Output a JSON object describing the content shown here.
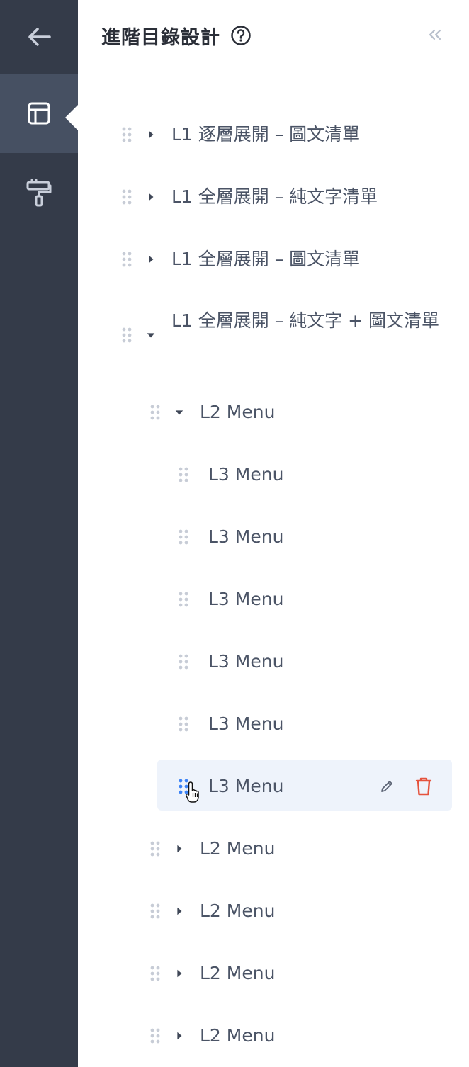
{
  "sidebar": {
    "items": [
      {
        "icon": "arrow-left-icon",
        "name": "back"
      },
      {
        "icon": "layout-icon",
        "name": "layout",
        "active": true
      },
      {
        "icon": "paint-roller-icon",
        "name": "theme"
      }
    ]
  },
  "panel": {
    "title": "進階目錄設計",
    "help_icon": "question-circle-icon",
    "collapse_icon": "double-chevron-left-icon"
  },
  "tree": {
    "l1_1": "L1 逐層展開 – 圖文清單",
    "l1_2": "L1 全層展開 – 純文字清單",
    "l1_3": "L1 全層展開 – 圖文清單",
    "l1_4": "L1 全層展開 – 純文字 + 圖文清單",
    "l2_1": "L2 Menu",
    "l3_1": "L3 Menu",
    "l3_2": "L3 Menu",
    "l3_3": "L3 Menu",
    "l3_4": "L3 Menu",
    "l3_5": "L3 Menu",
    "l3_6": "L3 Menu",
    "l2_2": "L2 Menu",
    "l2_3": "L2 Menu",
    "l2_4": "L2 Menu",
    "l2_5": "L2 Menu"
  },
  "colors": {
    "rail_bg": "#343b49",
    "rail_active": "#465062",
    "text": "#4b5466",
    "hover_bg": "#eef3fb",
    "drag_active": "#3b82f6",
    "delete": "#e5533d"
  }
}
